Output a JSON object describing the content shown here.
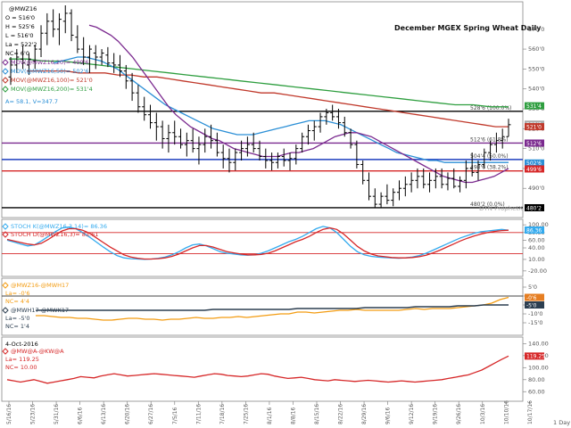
{
  "chart_data": [
    {
      "type": "line",
      "panel": "price",
      "title": "December MGEX Spring Wheat Daily",
      "symbol": "@MWZ16",
      "ohlc_readout": {
        "o": "O = 516'0",
        "h": "H = 525'6",
        "l": "L = 516'0",
        "la": "La = 522'2",
        "nc": "NC= 6'0"
      },
      "ylim": [
        478,
        582
      ],
      "yticks": [
        490,
        500,
        510,
        520,
        530,
        540,
        550,
        560,
        570,
        580
      ],
      "yticks_labels": [
        "490'0",
        "500'0",
        "510'0",
        "520'0",
        "530'0",
        "540'0",
        "550'0",
        "560'0",
        "570'0"
      ],
      "ma_legend": [
        {
          "name": "MOV(@MWZ16,20)= 499'6",
          "color": "#7b2a8f"
        },
        {
          "name": "MOV(@MWZ16,50)= 502'6",
          "color": "#2b8fd6"
        },
        {
          "name": "MOV(@MWZ16,100)= 521'0",
          "color": "#c0392b"
        },
        {
          "name": "MOV(@MWZ16,200)= 531'4",
          "color": "#2e9e3f"
        }
      ],
      "extra_legend": "A= 58.1, V=347.7",
      "levels": [
        {
          "value": 528.75,
          "label": "528'6 (100.0%)",
          "color": "#000000"
        },
        {
          "value": 512.75,
          "label": "512'6 (61.8%)",
          "color": "#7b2a8f"
        },
        {
          "value": 504.5,
          "label": "504'4 (50.0%)",
          "color": "#1f3fbf"
        },
        {
          "value": 498.75,
          "label": "498'6 (38.2%)",
          "color": "#d62728"
        },
        {
          "value": 480.25,
          "label": "480'2 (0.0%)",
          "color": "#000000"
        }
      ],
      "right_tags": [
        {
          "value": 531.5,
          "label": "531'4",
          "color": "#2e9e3f"
        },
        {
          "value": 522.25,
          "label": "522'2",
          "color": "#aaaaaa"
        },
        {
          "value": 521,
          "label": "521'0",
          "color": "#c0392b"
        },
        {
          "value": 512.75,
          "label": "512'6",
          "color": "#7b2a8f"
        },
        {
          "value": 502.75,
          "label": "502'6",
          "color": "#2b8fd6"
        },
        {
          "value": 499.75,
          "label": "499'6",
          "color": "#d62728"
        },
        {
          "value": 480.25,
          "label": "480'2",
          "color": "#000000"
        }
      ],
      "watermark": "DTN ProphetX",
      "price_bars": [
        [
          546,
          556,
          542,
          552
        ],
        [
          552,
          560,
          548,
          556
        ],
        [
          555,
          562,
          550,
          553
        ],
        [
          552,
          558,
          547,
          555
        ],
        [
          554,
          562,
          550,
          560
        ],
        [
          560,
          572,
          556,
          568
        ],
        [
          568,
          578,
          562,
          574
        ],
        [
          574,
          580,
          566,
          570
        ],
        [
          570,
          578,
          562,
          575
        ],
        [
          574,
          582,
          568,
          578
        ],
        [
          578,
          580,
          564,
          567
        ],
        [
          566,
          572,
          558,
          560
        ],
        [
          560,
          566,
          552,
          556
        ],
        [
          556,
          562,
          548,
          560
        ],
        [
          558,
          562,
          550,
          556
        ],
        [
          556,
          560,
          552,
          558
        ],
        [
          557,
          561,
          551,
          553
        ],
        [
          553,
          558,
          548,
          552
        ],
        [
          552,
          557,
          546,
          549
        ],
        [
          549,
          552,
          540,
          544
        ],
        [
          544,
          548,
          534,
          538
        ],
        [
          538,
          542,
          528,
          531
        ],
        [
          531,
          536,
          524,
          527
        ],
        [
          527,
          532,
          520,
          523
        ],
        [
          523,
          528,
          514,
          521
        ],
        [
          521,
          524,
          510,
          515
        ],
        [
          515,
          522,
          508,
          518
        ],
        [
          518,
          524,
          512,
          516
        ],
        [
          516,
          520,
          510,
          512
        ],
        [
          512,
          518,
          506,
          514
        ],
        [
          514,
          520,
          508,
          510
        ],
        [
          510,
          516,
          502,
          512
        ],
        [
          512,
          520,
          508,
          516
        ],
        [
          516,
          522,
          510,
          514
        ],
        [
          514,
          518,
          506,
          508
        ],
        [
          508,
          512,
          500,
          505
        ],
        [
          505,
          510,
          498,
          503
        ],
        [
          503,
          510,
          499,
          508
        ],
        [
          508,
          514,
          504,
          510
        ],
        [
          510,
          516,
          506,
          512
        ],
        [
          512,
          518,
          508,
          510
        ],
        [
          510,
          514,
          504,
          506
        ],
        [
          506,
          510,
          500,
          504
        ],
        [
          504,
          508,
          499,
          503
        ],
        [
          503,
          508,
          500,
          506
        ],
        [
          506,
          510,
          501,
          504
        ],
        [
          504,
          508,
          499,
          505
        ],
        [
          505,
          512,
          502,
          510
        ],
        [
          510,
          518,
          508,
          516
        ],
        [
          516,
          522,
          512,
          519
        ],
        [
          519,
          524,
          514,
          521
        ],
        [
          521,
          528,
          518,
          526
        ],
        [
          526,
          530,
          522,
          528
        ],
        [
          528,
          532,
          524,
          526
        ],
        [
          526,
          530,
          520,
          523
        ],
        [
          523,
          526,
          516,
          518
        ],
        [
          518,
          520,
          510,
          512
        ],
        [
          512,
          514,
          500,
          502
        ],
        [
          502,
          504,
          492,
          494
        ],
        [
          494,
          498,
          484,
          486
        ],
        [
          486,
          490,
          480,
          482
        ],
        [
          482,
          488,
          480,
          486
        ],
        [
          486,
          492,
          482,
          484
        ],
        [
          484,
          490,
          481,
          488
        ],
        [
          488,
          494,
          484,
          490
        ],
        [
          490,
          496,
          486,
          492
        ],
        [
          492,
          498,
          488,
          494
        ],
        [
          494,
          500,
          490,
          496
        ],
        [
          496,
          500,
          490,
          492
        ],
        [
          492,
          498,
          488,
          494
        ],
        [
          494,
          500,
          490,
          496
        ],
        [
          496,
          500,
          490,
          492
        ],
        [
          492,
          498,
          489,
          495
        ],
        [
          495,
          500,
          490,
          491
        ],
        [
          491,
          496,
          488,
          494
        ],
        [
          494,
          504,
          490,
          500
        ],
        [
          500,
          508,
          496,
          498
        ],
        [
          498,
          504,
          494,
          502
        ],
        [
          502,
          510,
          500,
          508
        ],
        [
          508,
          514,
          504,
          512
        ],
        [
          512,
          518,
          508,
          514
        ],
        [
          514,
          520,
          510,
          516
        ],
        [
          516,
          525,
          516,
          522
        ]
      ],
      "ma20": [
        572,
        571,
        569,
        567,
        564,
        560,
        556,
        551,
        546,
        541,
        536,
        531,
        527,
        524,
        521,
        519,
        517,
        515,
        514,
        512,
        510,
        509,
        508,
        507,
        506,
        506,
        506,
        507,
        508,
        508,
        509,
        510,
        512,
        514,
        516,
        517,
        518,
        518,
        517,
        516,
        514,
        512,
        510,
        508,
        506,
        504,
        502,
        500,
        498,
        496,
        495,
        494,
        493,
        493,
        494,
        495,
        496,
        498,
        500
      ],
      "ma50": [
        553,
        554,
        555,
        556,
        556,
        555,
        554,
        552,
        550,
        547,
        544,
        541,
        538,
        535,
        532,
        530,
        528,
        526,
        524,
        522,
        520,
        519,
        518,
        517,
        517,
        517,
        518,
        519,
        520,
        521,
        522,
        523,
        524,
        524,
        524,
        523,
        522,
        520,
        518,
        516,
        514,
        512,
        510,
        508,
        507,
        506,
        505,
        504,
        504,
        503,
        503,
        503,
        503,
        503,
        503,
        503,
        503,
        503
      ],
      "ma100": [
        549,
        549,
        549,
        549,
        548,
        548,
        548,
        547,
        547,
        546,
        546,
        545,
        544,
        543,
        542,
        541,
        540,
        539,
        538,
        538,
        537,
        536,
        535,
        534,
        533,
        532,
        531,
        530,
        529,
        528,
        527,
        526,
        525,
        524,
        523,
        522,
        521,
        521
      ],
      "ma200": [
        555,
        555,
        554,
        554,
        553,
        552,
        551,
        550,
        549,
        548,
        547,
        546,
        545,
        544,
        543,
        542,
        541,
        540,
        539,
        538,
        537,
        536,
        535,
        534,
        533,
        532,
        532,
        531,
        531
      ]
    },
    {
      "type": "line",
      "panel": "stochastics",
      "legend": [
        {
          "name": "STOCH K(@MWZ16,3,14)= 86.36",
          "color": "#33aaee"
        },
        {
          "name": "STOCH D(@MWZ16,3)= 83.61",
          "color": "#d62728"
        }
      ],
      "ylim": [
        -25,
        105
      ],
      "yticks": [
        100,
        80,
        60,
        40,
        10,
        -20
      ],
      "yticks_labels": [
        "100.00",
        "80.00",
        "60.00",
        "40.00",
        "10.00",
        "-20.00"
      ],
      "levels": [
        80,
        25
      ],
      "right_tags": [
        {
          "value": 86.36,
          "label": "86.36",
          "color": "#33aaee"
        }
      ],
      "k": [
        60,
        55,
        50,
        45,
        48,
        58,
        70,
        82,
        92,
        94,
        90,
        80,
        68,
        55,
        42,
        30,
        20,
        14,
        12,
        11,
        10,
        11,
        13,
        16,
        22,
        30,
        40,
        48,
        50,
        45,
        38,
        30,
        26,
        24,
        22,
        21,
        22,
        26,
        32,
        40,
        48,
        56,
        62,
        70,
        80,
        90,
        96,
        92,
        80,
        62,
        44,
        30,
        22,
        18,
        16,
        15,
        14,
        13,
        14,
        16,
        20,
        26,
        34,
        42,
        50,
        58,
        66,
        72,
        78,
        82,
        84,
        86,
        88,
        86
      ],
      "d": [
        62,
        58,
        54,
        50,
        48,
        52,
        62,
        74,
        84,
        90,
        90,
        86,
        78,
        66,
        54,
        42,
        32,
        22,
        16,
        13,
        11,
        11,
        12,
        14,
        18,
        24,
        32,
        40,
        46,
        46,
        42,
        36,
        30,
        27,
        24,
        22,
        22,
        23,
        26,
        32,
        40,
        48,
        56,
        62,
        70,
        80,
        88,
        92,
        88,
        76,
        60,
        44,
        32,
        24,
        19,
        17,
        15,
        14,
        14,
        15,
        17,
        21,
        27,
        34,
        42,
        50,
        58,
        65,
        71,
        76,
        80,
        83,
        85,
        86
      ]
    },
    {
      "type": "line",
      "panel": "spreads",
      "legend": [
        {
          "name": "@MWZ16-@MWH17",
          "color": "#f39c12"
        },
        {
          "name": "La= -0'6",
          "color": "#f39c12"
        },
        {
          "name": "NC= 4'4",
          "color": "#f39c12"
        },
        {
          "name": "@MWH17-@MWK17",
          "color": "#2c3e50"
        },
        {
          "name": "La= -5'0",
          "color": "#2c3e50"
        },
        {
          "name": "NC= 1'4",
          "color": "#2c3e50"
        }
      ],
      "ylim": [
        -20,
        8
      ],
      "yticks": [
        5,
        0,
        -5,
        -10,
        -15
      ],
      "yticks_labels": [
        "5'0",
        "0'0",
        "-5'0",
        "-10'0",
        "-15'0"
      ],
      "levels": [
        0
      ],
      "right_tags": [
        {
          "value": -0.75,
          "label": "-0'6",
          "color": "#e67e22"
        },
        {
          "value": -5,
          "label": "-5'0",
          "color": "#2c3e50"
        }
      ],
      "z_h": [
        -11,
        -11,
        -11.5,
        -12,
        -12,
        -12.5,
        -12.5,
        -13,
        -13.5,
        -13.5,
        -13,
        -12.5,
        -12.5,
        -13,
        -13,
        -13.5,
        -13,
        -13,
        -12.5,
        -12,
        -12.5,
        -12.5,
        -12,
        -12,
        -11.5,
        -12,
        -11.5,
        -11,
        -10.5,
        -10,
        -10,
        -9,
        -9,
        -9.5,
        -9,
        -8.5,
        -8,
        -8,
        -7.5,
        -8,
        -8,
        -8,
        -8,
        -8,
        -7.5,
        -7,
        -7.5,
        -7,
        -7,
        -7,
        -6.5,
        -6,
        -5.5,
        -5,
        -4,
        -2,
        -0.75
      ],
      "h_k": [
        -8,
        -8,
        -8,
        -8,
        -8,
        -8,
        -8,
        -8,
        -8,
        -8,
        -8,
        -8,
        -8,
        -8,
        -8,
        -8,
        -8,
        -8,
        -8,
        -8,
        -8,
        -7.5,
        -7.5,
        -7.5,
        -7.5,
        -7.5,
        -7.5,
        -7.5,
        -7.5,
        -7.5,
        -7.5,
        -7,
        -7,
        -7,
        -7,
        -7,
        -7,
        -7,
        -7,
        -6.5,
        -6.5,
        -6.5,
        -6.5,
        -6.5,
        -6.5,
        -6,
        -6,
        -6,
        -6,
        -6,
        -5.5,
        -5.5,
        -5.5,
        -5,
        -5,
        -5,
        -5
      ]
    },
    {
      "type": "line",
      "panel": "ratio",
      "date": "4-Oct-2016",
      "legend": [
        {
          "name": "@MW@A-@KW@A",
          "color": "#d62728"
        },
        {
          "name": "La= 119.25",
          "color": "#d62728"
        },
        {
          "name": "NC= 10.00",
          "color": "#d62728"
        }
      ],
      "ylim": [
        50,
        145
      ],
      "yticks": [
        140,
        120,
        100,
        80,
        60
      ],
      "yticks_labels": [
        "140.00",
        "120.00",
        "100.00",
        "80.00",
        "60.00"
      ],
      "right_tags": [
        {
          "value": 119.25,
          "label": "119.25",
          "color": "#d62728"
        }
      ],
      "values": [
        80,
        78,
        76,
        78,
        80,
        77,
        74,
        76,
        78,
        80,
        82,
        85,
        84,
        83,
        86,
        88,
        90,
        88,
        86,
        87,
        88,
        89,
        90,
        89,
        88,
        87,
        86,
        85,
        84,
        86,
        88,
        90,
        89,
        87,
        86,
        85,
        86,
        88,
        90,
        89,
        86,
        84,
        82,
        83,
        84,
        82,
        80,
        79,
        78,
        80,
        79,
        78,
        77,
        78,
        79,
        78,
        77,
        76,
        77,
        78,
        77,
        76,
        77,
        78,
        79,
        80,
        82,
        84,
        86,
        88,
        92,
        96,
        102,
        108,
        114,
        119.25
      ]
    },
    {
      "type": "table",
      "panel": "date-axis",
      "x": [
        "5/16/16",
        "5/23/16",
        "5/31/16",
        "6/6/16",
        "6/13/16",
        "6/20/16",
        "6/27/16",
        "7/5/16",
        "7/11/16",
        "7/18/16",
        "7/25/16",
        "8/1/16",
        "8/8/16",
        "8/15/16",
        "8/22/16",
        "8/29/16",
        "9/6/16",
        "9/12/16",
        "9/19/16",
        "9/26/16",
        "10/3/16",
        "10/10/16",
        "10/17/16"
      ],
      "period": "1 Day"
    }
  ]
}
